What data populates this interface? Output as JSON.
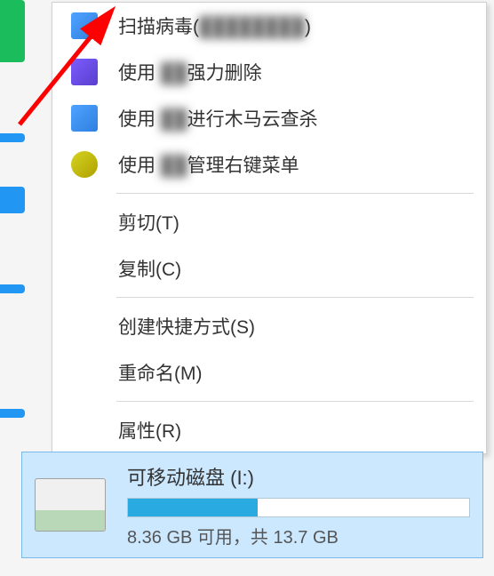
{
  "menu": {
    "scan": {
      "prefix": "扫描病毒(",
      "blur": "████████",
      "suffix": ")"
    },
    "delete": {
      "prefix": "使用 ",
      "blur": "██",
      "suffix": "强力删除"
    },
    "trojan": {
      "prefix": "使用 ",
      "blur": "██",
      "suffix": "进行木马云查杀"
    },
    "rightclick": {
      "prefix": "使用 ",
      "blur": "██",
      "suffix": "管理右键菜单"
    },
    "cut": "剪切(T)",
    "copy": "复制(C)",
    "shortcut": "创建快捷方式(S)",
    "rename": "重命名(M)",
    "properties": "属性(R)"
  },
  "drive": {
    "name": "可移动磁盘 (I:)",
    "stats": "8.36 GB 可用，共 13.7 GB",
    "fill_percent": 38
  }
}
